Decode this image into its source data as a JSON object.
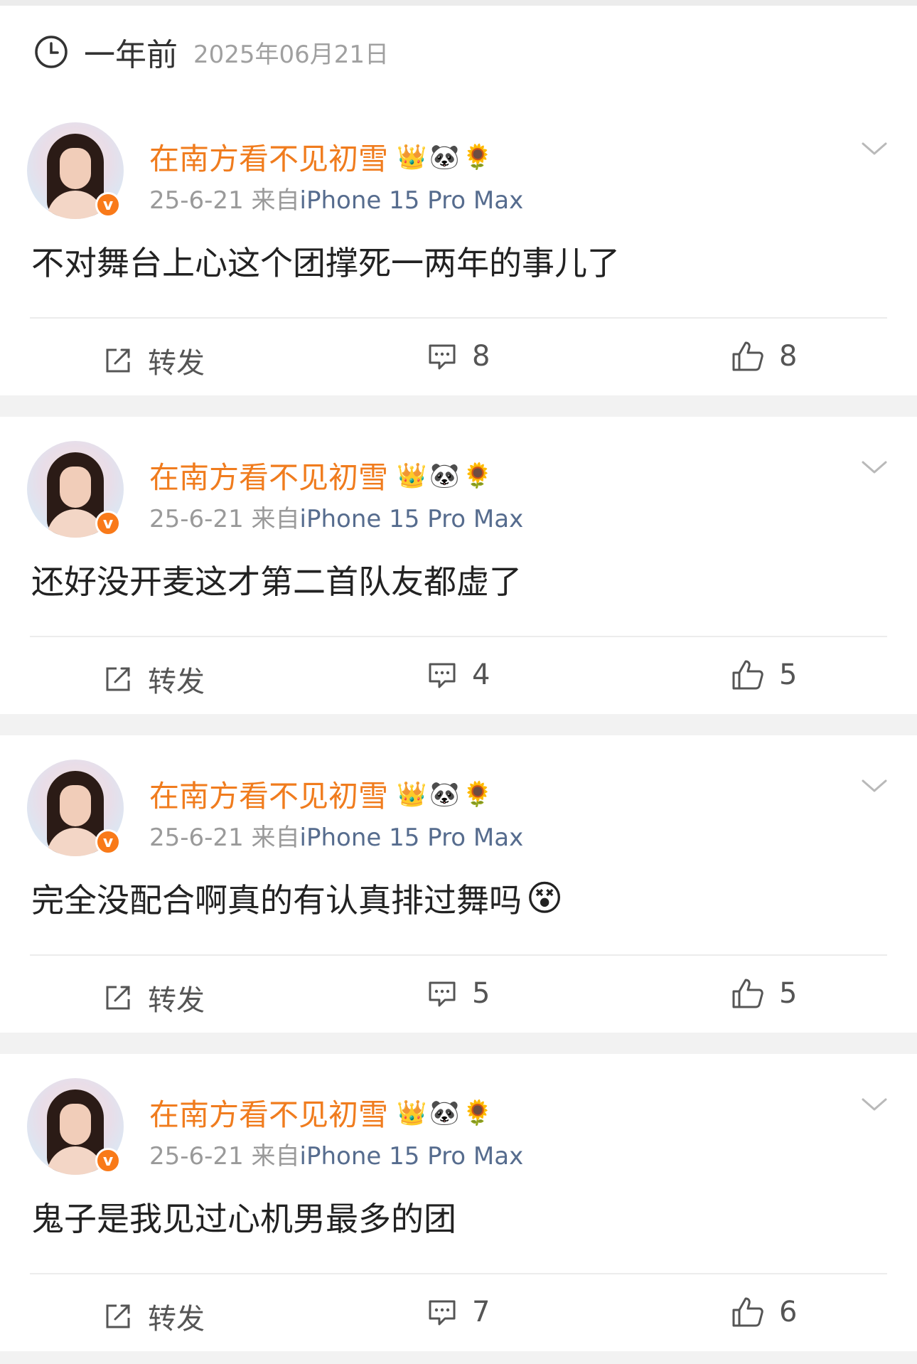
{
  "header": {
    "relative_time": "一年前",
    "date": "2025年06月21日"
  },
  "posts": [
    {
      "username": "在南方看不见初雪",
      "date": "25-6-21",
      "from_prefix": "来自",
      "source": "iPhone 15 Pro Max",
      "content": "不对舞台上心这个团撑死一两年的事儿了",
      "repost_label": "转发",
      "comments": "8",
      "likes": "8"
    },
    {
      "username": "在南方看不见初雪",
      "date": "25-6-21",
      "from_prefix": "来自",
      "source": "iPhone 15 Pro Max",
      "content": "还好没开麦这才第二首队友都虚了",
      "repost_label": "转发",
      "comments": "4",
      "likes": "5"
    },
    {
      "username": "在南方看不见初雪",
      "date": "25-6-21",
      "from_prefix": "来自",
      "source": "iPhone 15 Pro Max",
      "content": "完全没配合啊真的有认真排过舞吗",
      "repost_label": "转发",
      "comments": "5",
      "likes": "5"
    },
    {
      "username": "在南方看不见初雪",
      "date": "25-6-21",
      "from_prefix": "来自",
      "source": "iPhone 15 Pro Max",
      "content": "鬼子是我见过心机男最多的团",
      "repost_label": "转发",
      "comments": "7",
      "likes": "6"
    }
  ],
  "icons": {
    "clock": "clock-icon",
    "verified": "verified-badge-icon",
    "crown": "crown-badge-icon",
    "panda": "panda-badge-icon",
    "flower": "sunflower-badge-icon",
    "chevron": "chevron-down-icon",
    "repost": "repost-icon",
    "comment": "comment-icon",
    "like": "thumbs-up-icon",
    "dizzy": "dizzy-face-emoji"
  },
  "colors": {
    "username": "#f07c1e",
    "source": "#566c8e",
    "verified": "#f97a19",
    "meta": "#9a9a9a"
  }
}
